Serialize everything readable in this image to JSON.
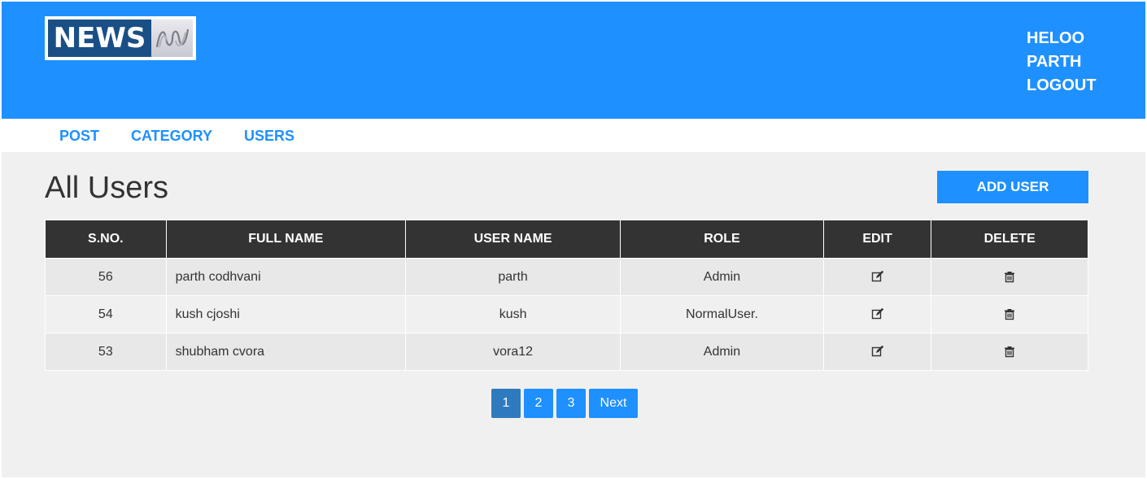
{
  "header": {
    "logo_text": "NEWS",
    "user_menu": {
      "greeting": "HELOO",
      "username": "PARTH",
      "logout": "LOGOUT"
    }
  },
  "nav": {
    "items": [
      {
        "label": "POST"
      },
      {
        "label": "CATEGORY"
      },
      {
        "label": "USERS"
      }
    ]
  },
  "main": {
    "title": "All Users",
    "add_button": "ADD USER",
    "table": {
      "columns": [
        "S.NO.",
        "FULL NAME",
        "USER NAME",
        "ROLE",
        "EDIT",
        "DELETE"
      ],
      "rows": [
        {
          "sno": "56",
          "full_name": "parth codhvani",
          "user_name": "parth",
          "role": "Admin"
        },
        {
          "sno": "54",
          "full_name": "kush cjoshi",
          "user_name": "kush",
          "role": "NormalUser."
        },
        {
          "sno": "53",
          "full_name": "shubham cvora",
          "user_name": "vora12",
          "role": "Admin"
        }
      ]
    },
    "pagination": {
      "pages": [
        "1",
        "2",
        "3"
      ],
      "current": "1",
      "next_label": "Next"
    }
  },
  "icons": {
    "edit": "edit-icon",
    "delete": "trash-icon"
  },
  "colors": {
    "brand_blue": "#1e90ff",
    "header_dark": "#333333",
    "active_page": "#2f7abf",
    "logo_blue": "#1a4f86"
  }
}
